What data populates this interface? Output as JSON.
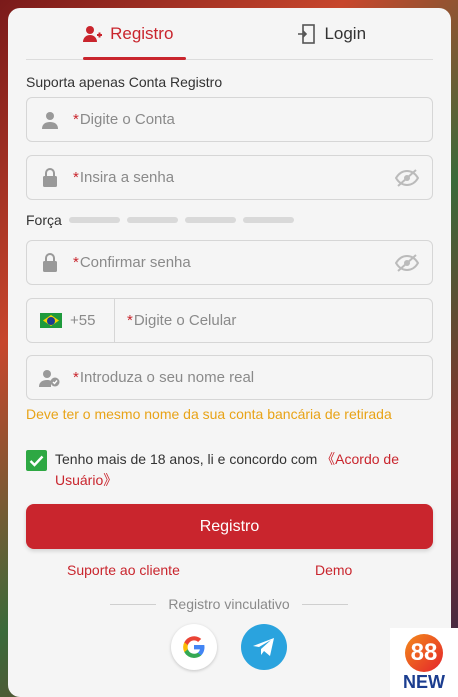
{
  "tabs": [
    {
      "label": "Registro",
      "icon": "add-user-icon",
      "active": true
    },
    {
      "label": "Login",
      "icon": "login-door-icon",
      "active": false
    }
  ],
  "note": "Suporta apenas Conta Registro",
  "fields": {
    "account": {
      "required": "*",
      "placeholder": "Digite o Conta",
      "icon": "user-icon"
    },
    "password": {
      "required": "*",
      "placeholder": "Insira a senha",
      "icon": "lock-icon",
      "toggle": "eye-off-icon"
    },
    "confirm": {
      "required": "*",
      "placeholder": "Confirmar senha",
      "icon": "lock-icon",
      "toggle": "eye-off-icon"
    },
    "phone": {
      "country_code": "+55",
      "country": "brazil-flag-icon",
      "required": "*",
      "placeholder": "Digite o Celular"
    },
    "realname": {
      "required": "*",
      "placeholder": "Introduza o seu nome real",
      "icon": "user-verified-icon"
    }
  },
  "strength": {
    "label": "Força",
    "level": 0,
    "segments": 4
  },
  "realname_hint": "Deve ter o mesmo nome da sua conta bancária de retirada",
  "agreement": {
    "checked": true,
    "text": "Tenho mais de 18 anos, li e concordo com ",
    "link": "《Acordo de Usuário》"
  },
  "submit_label": "Registro",
  "links": {
    "support": "Suporte ao cliente",
    "demo": "Demo"
  },
  "divider_label": "Registro vinculativo",
  "social": [
    {
      "name": "google-icon",
      "letter": "G"
    },
    {
      "name": "telegram-icon"
    }
  ],
  "badge": {
    "logo": "88",
    "label": "NEW"
  },
  "colors": {
    "accent": "#c9252d",
    "hint": "#e8a317",
    "check": "#2ea843",
    "telegram": "#2aa3de"
  }
}
